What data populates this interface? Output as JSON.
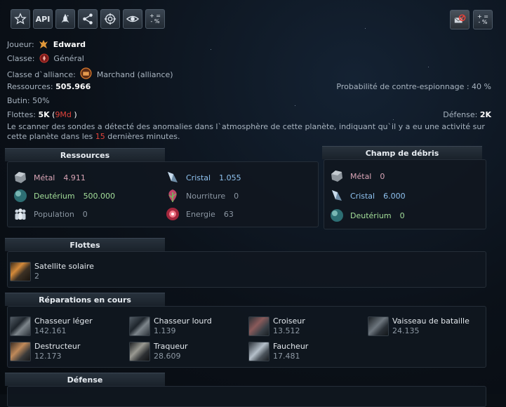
{
  "toolbar": {
    "left_buttons": [
      {
        "icon": "star-icon"
      },
      {
        "icon": "api-icon",
        "label": "API"
      },
      {
        "icon": "rocket-icon"
      },
      {
        "icon": "share-icon"
      },
      {
        "icon": "target-icon"
      },
      {
        "icon": "eye-icon"
      },
      {
        "icon": "plus-minus-percent-icon",
        "label_top": "+ =",
        "label_bottom": "- %"
      }
    ],
    "right_buttons": [
      {
        "icon": "no-mail-icon"
      },
      {
        "icon": "plus-minus-percent-icon",
        "label_top": "+ =",
        "label_bottom": "- %"
      }
    ]
  },
  "info": {
    "player_label": "Joueur:",
    "player_name": "Edward",
    "class_label": "Classe:",
    "class_value": "Général",
    "alliance_class_label": "Classe d`alliance:",
    "alliance_class_value": "Marchand (alliance)",
    "resources_label": "Ressources:",
    "resources_value": "505.966",
    "counter_espionage_label": "Probabilité de contre-espionnage :",
    "counter_espionage_value": "40 %",
    "loot_label": "Butin:",
    "loot_value": "50%",
    "fleets_label": "Flottes:",
    "fleets_value": "5K",
    "fleets_paren_open": "(",
    "fleets_red": "9Md",
    "fleets_paren_close": ")",
    "defense_label": "Défense:",
    "defense_value": "2K",
    "scanner_msg_part1": "Le scanner des sondes a détecté des anomalies dans l`atmosphère de cette planète, indiquant qu`il y a eu une activité sur",
    "scanner_msg_part2a": "cette planète dans les",
    "scanner_msg_minutes": "15",
    "scanner_msg_part2b": "dernières minutes."
  },
  "resources_section": {
    "title": "Ressources",
    "items": [
      {
        "name": "Métal",
        "value": "4.911",
        "icon": "metal-icon"
      },
      {
        "name": "Cristal",
        "value": "1.055",
        "icon": "crystal-icon"
      },
      {
        "name": "Deutérium",
        "value": "500.000",
        "icon": "deuterium-icon"
      },
      {
        "name": "Nourriture",
        "value": "0",
        "icon": "food-icon"
      },
      {
        "name": "Population",
        "value": "0",
        "icon": "population-icon"
      },
      {
        "name": "Energie",
        "value": "63",
        "icon": "energy-icon"
      }
    ]
  },
  "debris_section": {
    "title": "Champ de débris",
    "items": [
      {
        "name": "Métal",
        "value": "0",
        "icon": "metal-icon"
      },
      {
        "name": "Cristal",
        "value": "6.000",
        "icon": "crystal-icon"
      },
      {
        "name": "Deutérium",
        "value": "0",
        "icon": "deuterium-icon"
      }
    ]
  },
  "fleets_section": {
    "title": "Flottes",
    "ships": [
      {
        "name": "Satellite solaire",
        "count": "2"
      }
    ]
  },
  "repairs_section": {
    "title": "Réparations en cours",
    "ships": [
      {
        "name": "Chasseur léger",
        "count": "142.161"
      },
      {
        "name": "Chasseur lourd",
        "count": "1.139"
      },
      {
        "name": "Croiseur",
        "count": "13.512"
      },
      {
        "name": "Vaisseau de bataille",
        "count": "24.135"
      },
      {
        "name": "Destructeur",
        "count": "12.173"
      },
      {
        "name": "Traqueur",
        "count": "28.609"
      },
      {
        "name": "Faucheur",
        "count": "17.481"
      }
    ]
  },
  "defense_section": {
    "title": "Défense"
  },
  "colors": {
    "metal": "#d9a5b6",
    "crystal": "#8fc2ef",
    "deuterium": "#a4df9a",
    "alert_red": "#e0423a"
  }
}
